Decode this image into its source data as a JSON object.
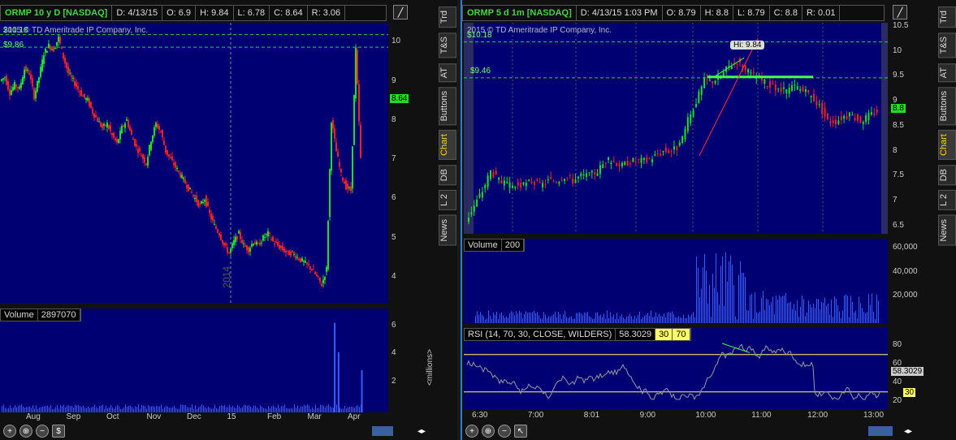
{
  "left": {
    "header": {
      "symbol": "ORMP 10 y D [NASDAQ]",
      "date": "D: 4/13/15",
      "open": "O: 6.9",
      "high": "H: 9.84",
      "low": "L: 6.78",
      "close": "C: 8.64",
      "range": "R: 3.06"
    },
    "copyright": "2015 © TD Ameritrade IP Company, Inc.",
    "line_label_top": "$10.18",
    "line_label_mid": "$9.86",
    "last_price": "8.64",
    "year_label": "2014",
    "volume_label": "Volume",
    "volume_value": "2897070",
    "volume_units": "<millions>",
    "tabs": [
      "Trd",
      "T&S",
      "AT",
      "Buttons",
      "Chart",
      "DB",
      "L 2",
      "News"
    ],
    "active_tab": "Chart"
  },
  "right": {
    "header": {
      "symbol": "ORMP 5 d 1m [NASDAQ]",
      "date": "D: 4/13/15 1:03 PM",
      "open": "O: 8.79",
      "high": "H: 8.8",
      "low": "L: 8.79",
      "close": "C: 8.8",
      "range": "R: 0.01"
    },
    "copyright": "2015 © TD Ameritrade IP Company, Inc.",
    "line_label_top": "$10.18",
    "line_label_mid": "$9.46",
    "hi_label": "Hi: 9.84",
    "last_price": "8.8",
    "volume_label": "Volume",
    "volume_value": "200",
    "rsi_label": "RSI (14, 70, 30, CLOSE, WILDERS)",
    "rsi_value": "58.3029",
    "rsi_low": "30",
    "rsi_high": "70",
    "rsi_last": "58.3029",
    "rsi_30_tag": "30",
    "tabs": [
      "Trd",
      "T&S",
      "AT",
      "Buttons",
      "Chart",
      "DB",
      "L 2",
      "News"
    ],
    "active_tab": "Chart"
  },
  "colors": {
    "bg": "#000073",
    "up": "#22dd22",
    "down": "#ee2222",
    "volume": "#3a5cff",
    "rsi_line": "#9a9a9a",
    "rsi_level": "#ffff66",
    "dashed": "#33cc33"
  },
  "chart_data": [
    {
      "type": "candlestick",
      "title": "ORMP 10 y D [NASDAQ]",
      "x_ticks": [
        "Aug",
        "Sep",
        "Oct",
        "Nov",
        "Dec",
        "15",
        "Feb",
        "Mar",
        "Apr"
      ],
      "y_ticks": [
        4,
        5,
        6,
        7,
        8,
        9,
        10
      ],
      "ylim": [
        3.4,
        10.4
      ],
      "reference_lines": [
        10.18,
        9.86
      ],
      "series_path": [
        9.0,
        9.1,
        8.7,
        8.9,
        8.8,
        9.3,
        9.2,
        8.6,
        9.1,
        9.7,
        9.9,
        9.8,
        10.1,
        9.6,
        9.2,
        9.0,
        8.8,
        8.6,
        8.5,
        8.2,
        8.0,
        7.8,
        7.9,
        7.6,
        7.4,
        7.8,
        8.0,
        7.6,
        7.3,
        7.1,
        6.9,
        7.5,
        7.9,
        7.7,
        7.2,
        7.0,
        6.8,
        6.6,
        6.4,
        6.2,
        6.0,
        5.8,
        6.0,
        5.6,
        5.3,
        5.1,
        4.8,
        4.6,
        4.9,
        5.1,
        4.8,
        4.7,
        4.9,
        4.8,
        5.0,
        5.1,
        4.9,
        4.8,
        4.7,
        4.6,
        4.6,
        4.5,
        4.4,
        4.3,
        4.2,
        4.0,
        3.8,
        4.2,
        8.0,
        7.2,
        6.6,
        6.3,
        6.2,
        9.8,
        7.0
      ]
    },
    {
      "type": "bar",
      "title": "Volume",
      "y_ticks": [
        2,
        4,
        6
      ],
      "ylim": [
        0,
        7
      ],
      "units": "<millions>",
      "spikes": [
        {
          "x": 0.86,
          "value": 6.2
        },
        {
          "x": 0.87,
          "value": 4.1
        },
        {
          "x": 0.93,
          "value": 2.8
        }
      ]
    },
    {
      "type": "candlestick",
      "title": "ORMP 5 d 1m [NASDAQ]",
      "x_ticks": [
        "6:30",
        "7:00",
        "8:01",
        "9:00",
        "10:00",
        "11:00",
        "12:00",
        "13:00"
      ],
      "y_ticks": [
        6.5,
        7,
        7.5,
        8,
        8.5,
        9,
        9.5,
        10,
        10.5
      ],
      "ylim": [
        6.4,
        10.5
      ],
      "reference_lines": [
        10.18,
        9.46
      ],
      "series_path": [
        6.6,
        6.9,
        7.2,
        7.6,
        7.4,
        7.3,
        7.3,
        7.3,
        7.4,
        7.3,
        7.4,
        7.4,
        7.5,
        7.4,
        7.5,
        7.5,
        7.6,
        7.8,
        7.8,
        7.7,
        7.8,
        7.8,
        7.8,
        7.9,
        8.0,
        8.0,
        8.1,
        8.6,
        9.0,
        9.4,
        9.4,
        9.5,
        9.7,
        9.8,
        9.6,
        9.5,
        9.4,
        9.3,
        9.2,
        9.2,
        9.3,
        9.2,
        9.1,
        8.9,
        8.6,
        8.6,
        8.7,
        8.7,
        8.6,
        8.7,
        8.8
      ]
    },
    {
      "type": "bar",
      "title": "Volume",
      "y_ticks": [
        20000,
        40000,
        60000
      ],
      "ylim": [
        0,
        65000
      ]
    },
    {
      "type": "line",
      "title": "RSI (14, 70, 30, CLOSE, WILDERS)",
      "y_ticks": [
        20,
        40,
        60,
        80
      ],
      "ylim": [
        15,
        95
      ],
      "levels": [
        70,
        30
      ],
      "last": 58.3029
    }
  ]
}
